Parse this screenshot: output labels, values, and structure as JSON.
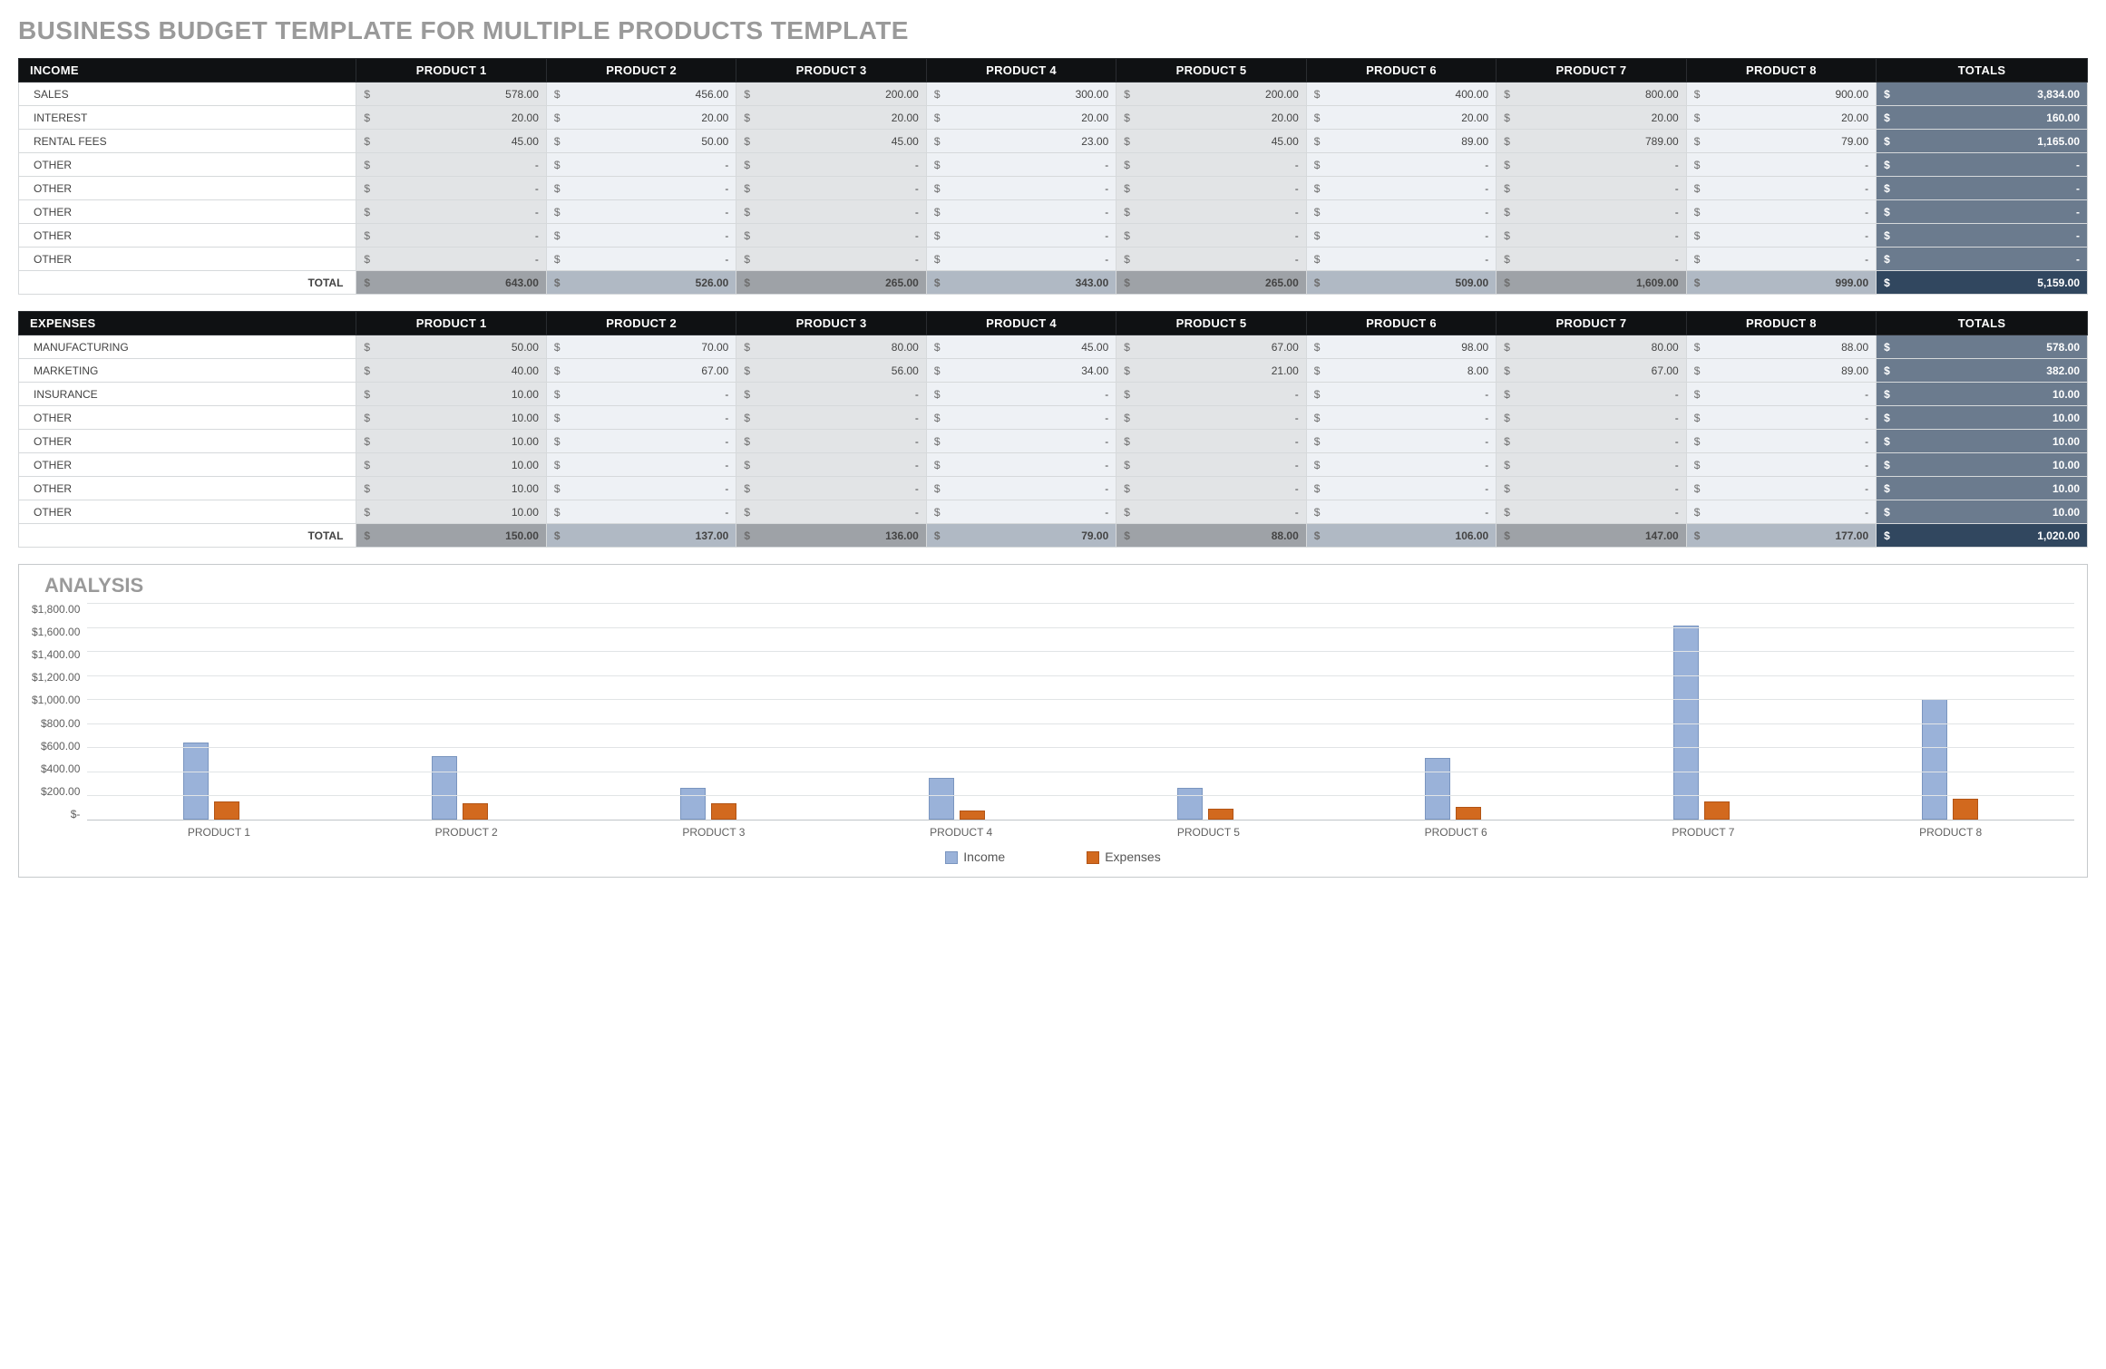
{
  "title": "BUSINESS BUDGET TEMPLATE FOR MULTIPLE PRODUCTS TEMPLATE",
  "products": [
    "PRODUCT 1",
    "PRODUCT 2",
    "PRODUCT 3",
    "PRODUCT 4",
    "PRODUCT 5",
    "PRODUCT 6",
    "PRODUCT 7",
    "PRODUCT 8"
  ],
  "totals_header": "TOTALS",
  "total_row_label": "TOTAL",
  "income": {
    "header": "INCOME",
    "rows": [
      {
        "label": "SALES",
        "vals": [
          "578.00",
          "456.00",
          "200.00",
          "300.00",
          "200.00",
          "400.00",
          "800.00",
          "900.00"
        ],
        "total": "3,834.00"
      },
      {
        "label": "INTEREST",
        "vals": [
          "20.00",
          "20.00",
          "20.00",
          "20.00",
          "20.00",
          "20.00",
          "20.00",
          "20.00"
        ],
        "total": "160.00"
      },
      {
        "label": "RENTAL FEES",
        "vals": [
          "45.00",
          "50.00",
          "45.00",
          "23.00",
          "45.00",
          "89.00",
          "789.00",
          "79.00"
        ],
        "total": "1,165.00"
      },
      {
        "label": "OTHER",
        "vals": [
          "-",
          "-",
          "-",
          "-",
          "-",
          "-",
          "-",
          "-"
        ],
        "total": "-"
      },
      {
        "label": "OTHER",
        "vals": [
          "-",
          "-",
          "-",
          "-",
          "-",
          "-",
          "-",
          "-"
        ],
        "total": "-"
      },
      {
        "label": "OTHER",
        "vals": [
          "-",
          "-",
          "-",
          "-",
          "-",
          "-",
          "-",
          "-"
        ],
        "total": "-"
      },
      {
        "label": "OTHER",
        "vals": [
          "-",
          "-",
          "-",
          "-",
          "-",
          "-",
          "-",
          "-"
        ],
        "total": "-"
      },
      {
        "label": "OTHER",
        "vals": [
          "-",
          "-",
          "-",
          "-",
          "-",
          "-",
          "-",
          "-"
        ],
        "total": "-"
      }
    ],
    "col_totals": [
      "643.00",
      "526.00",
      "265.00",
      "343.00",
      "265.00",
      "509.00",
      "1,609.00",
      "999.00"
    ],
    "grand_total": "5,159.00"
  },
  "expenses": {
    "header": "EXPENSES",
    "rows": [
      {
        "label": "MANUFACTURING",
        "vals": [
          "50.00",
          "70.00",
          "80.00",
          "45.00",
          "67.00",
          "98.00",
          "80.00",
          "88.00"
        ],
        "total": "578.00"
      },
      {
        "label": "MARKETING",
        "vals": [
          "40.00",
          "67.00",
          "56.00",
          "34.00",
          "21.00",
          "8.00",
          "67.00",
          "89.00"
        ],
        "total": "382.00"
      },
      {
        "label": "INSURANCE",
        "vals": [
          "10.00",
          "-",
          "-",
          "-",
          "-",
          "-",
          "-",
          "-"
        ],
        "total": "10.00"
      },
      {
        "label": "OTHER",
        "vals": [
          "10.00",
          "-",
          "-",
          "-",
          "-",
          "-",
          "-",
          "-"
        ],
        "total": "10.00"
      },
      {
        "label": "OTHER",
        "vals": [
          "10.00",
          "-",
          "-",
          "-",
          "-",
          "-",
          "-",
          "-"
        ],
        "total": "10.00"
      },
      {
        "label": "OTHER",
        "vals": [
          "10.00",
          "-",
          "-",
          "-",
          "-",
          "-",
          "-",
          "-"
        ],
        "total": "10.00"
      },
      {
        "label": "OTHER",
        "vals": [
          "10.00",
          "-",
          "-",
          "-",
          "-",
          "-",
          "-",
          "-"
        ],
        "total": "10.00"
      },
      {
        "label": "OTHER",
        "vals": [
          "10.00",
          "-",
          "-",
          "-",
          "-",
          "-",
          "-",
          "-"
        ],
        "total": "10.00"
      }
    ],
    "col_totals": [
      "150.00",
      "137.00",
      "136.00",
      "79.00",
      "88.00",
      "106.00",
      "147.00",
      "177.00"
    ],
    "grand_total": "1,020.00"
  },
  "chart_data": {
    "type": "bar",
    "title": "ANALYSIS",
    "categories": [
      "PRODUCT 1",
      "PRODUCT 2",
      "PRODUCT 3",
      "PRODUCT 4",
      "PRODUCT 5",
      "PRODUCT 6",
      "PRODUCT 7",
      "PRODUCT 8"
    ],
    "series": [
      {
        "name": "Income",
        "values": [
          643,
          526,
          265,
          343,
          265,
          509,
          1609,
          999
        ],
        "color": "#9ab2d9"
      },
      {
        "name": "Expenses",
        "values": [
          150,
          137,
          136,
          79,
          88,
          106,
          147,
          177
        ],
        "color": "#d2691e"
      }
    ],
    "ylim": [
      0,
      1800
    ],
    "yticks": [
      "$1,800.00",
      "$1,600.00",
      "$1,400.00",
      "$1,200.00",
      "$1,000.00",
      "$800.00",
      "$600.00",
      "$400.00",
      "$200.00",
      "$-"
    ],
    "xlabel": "",
    "ylabel": ""
  }
}
